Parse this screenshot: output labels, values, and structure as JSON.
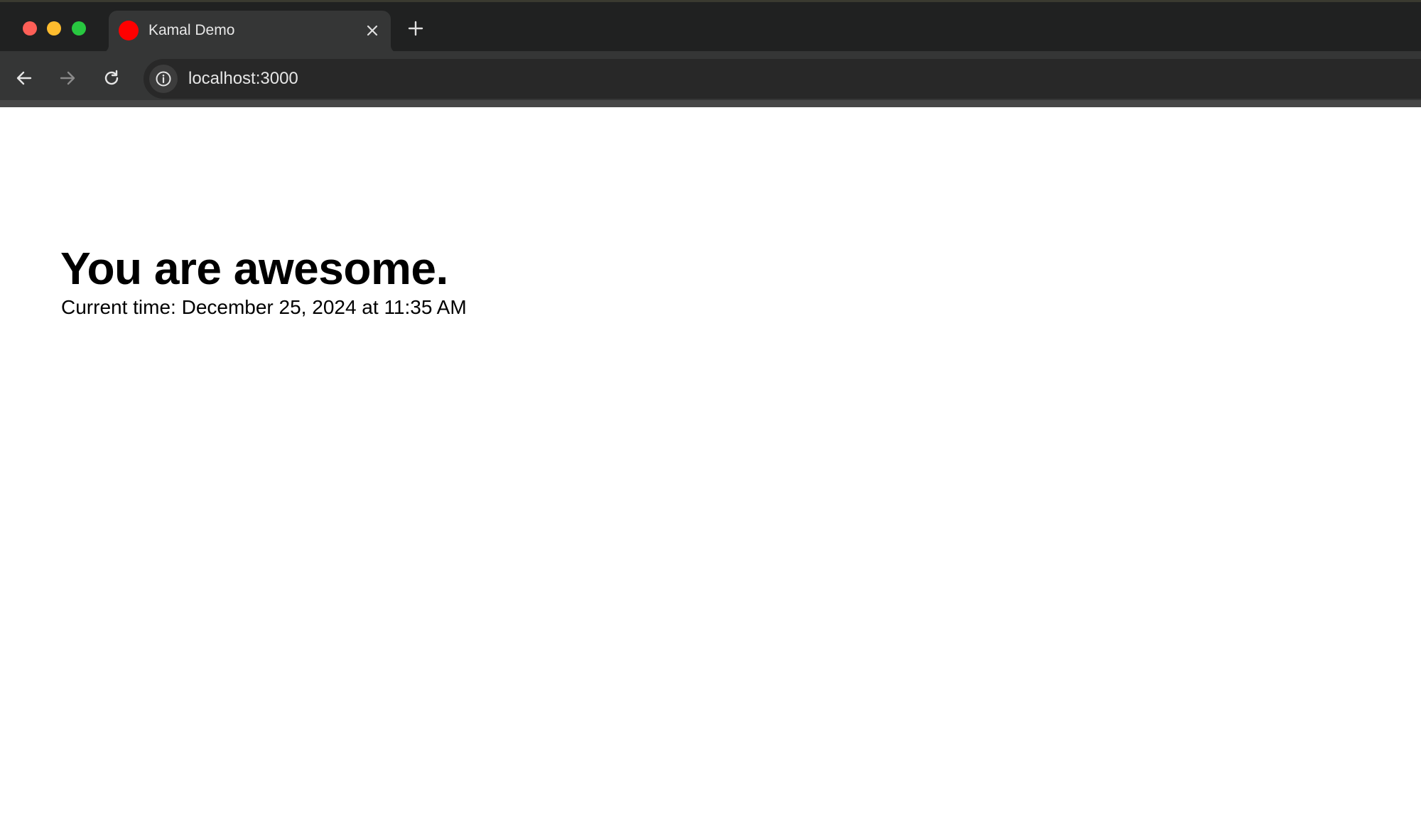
{
  "window": {
    "traffic_lights": {
      "close_color": "#fe5f57",
      "minimize_color": "#febc2e",
      "maximize_color": "#28c840"
    }
  },
  "tab": {
    "title": "Kamal Demo",
    "favicon_color": "#ff0000",
    "close_icon": "close-icon"
  },
  "new_tab_icon": "plus-icon",
  "toolbar": {
    "back_icon": "arrow-left-icon",
    "forward_icon": "arrow-right-icon",
    "reload_icon": "reload-icon",
    "site_info_icon": "info-icon",
    "url": "localhost:3000"
  },
  "page": {
    "heading": "You are awesome.",
    "current_time": "Current time: December 25, 2024 at 11:35 AM"
  }
}
